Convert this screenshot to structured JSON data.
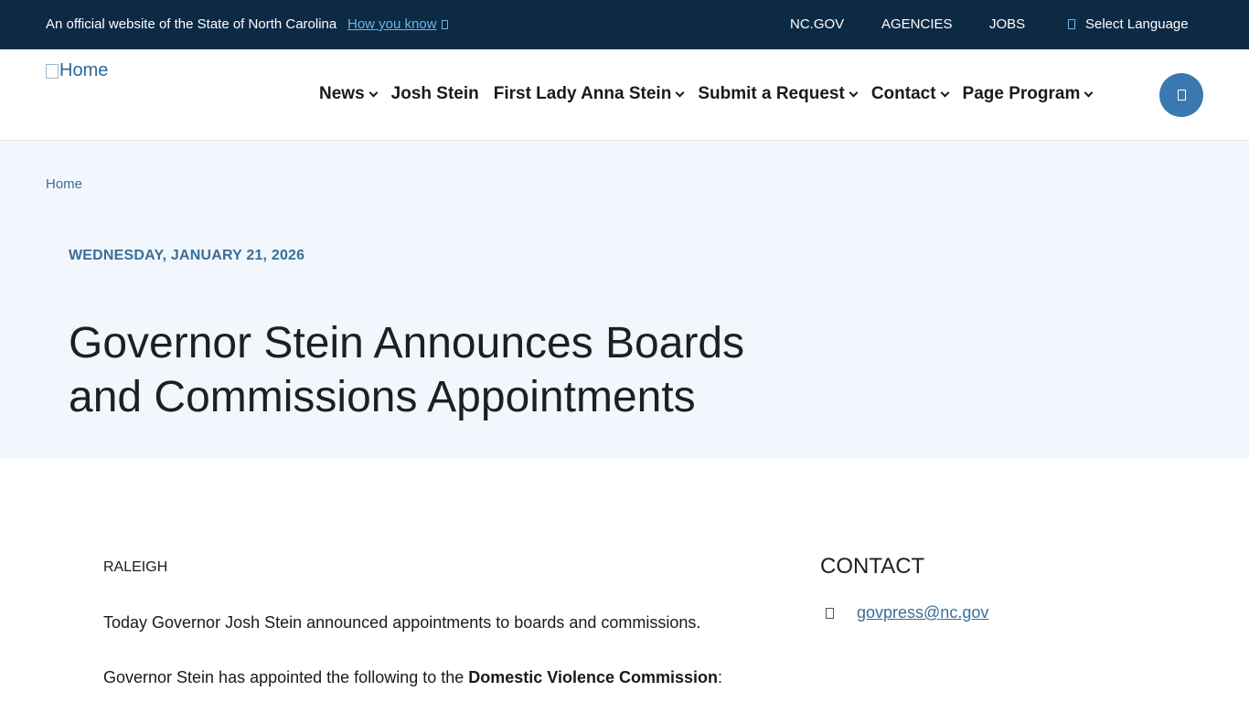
{
  "topbar": {
    "official_text": "An official website of the State of North Carolina",
    "how_you_know": "How you know",
    "links": [
      "NC.GOV",
      "AGENCIES",
      "JOBS"
    ],
    "language": "Select Language"
  },
  "header": {
    "logo_alt": "Home",
    "nav": [
      {
        "label": "News",
        "dropdown": true
      },
      {
        "label": "Josh Stein",
        "dropdown": false
      },
      {
        "label": "First Lady Anna Stein",
        "dropdown": true
      },
      {
        "label": "Submit a Request",
        "dropdown": true
      },
      {
        "label": "Contact",
        "dropdown": true
      },
      {
        "label": "Page Program",
        "dropdown": true
      }
    ]
  },
  "hero": {
    "breadcrumb": "Home",
    "date": "WEDNESDAY, JANUARY 21, 2026",
    "title": "Governor Stein Announces Boards and Commissions Appointments"
  },
  "article": {
    "dateline": "RALEIGH",
    "para1": "Today Governor Josh Stein announced appointments to boards and commissions.",
    "para2_prefix": "Governor Stein has appointed the following to the ",
    "para2_bold": "Domestic Violence Commission",
    "para2_suffix": ":"
  },
  "contact": {
    "heading": "CONTACT",
    "email": "govpress@nc.gov"
  },
  "colors": {
    "topbar_bg": "#0d2a45",
    "hero_bg": "#f1f7fd",
    "accent": "#3b77b0",
    "link": "#3b6e98"
  }
}
